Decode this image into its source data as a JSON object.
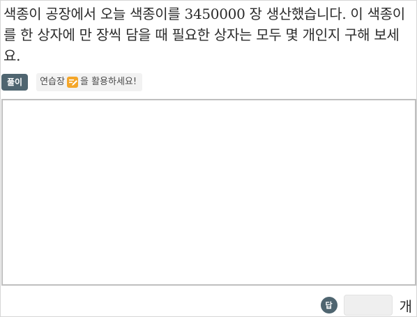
{
  "question": {
    "text": "색종이 공장에서 오늘 색종이를 3450000 장 생산했습니다. 이 색종이를 한 상자에 만 장씩 담을 때 필요한 상자는 모두 몇 개인지 구해 보세요."
  },
  "toolbar": {
    "solve_label": "풀이",
    "hint_prefix": "연습장",
    "hint_suffix": "을 활용하세요!",
    "hint_icon": "pencil-note-icon",
    "hint_icon_color": "#f4a62a"
  },
  "answer": {
    "badge_label": "답",
    "value": "",
    "unit": "개"
  },
  "colors": {
    "badge_bg": "#4f6570",
    "workpad_border": "#bfbfbf",
    "input_bg": "#efefef"
  }
}
